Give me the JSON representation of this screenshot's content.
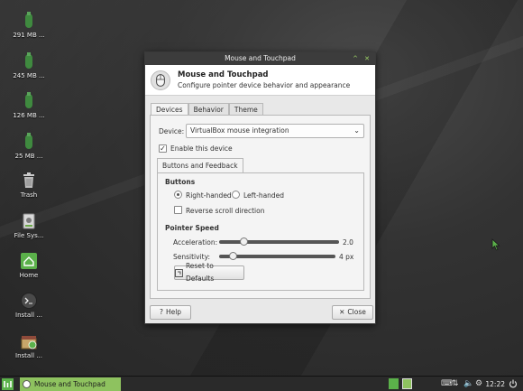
{
  "desktop": {
    "icons": [
      {
        "label": "291 MB ...",
        "icon": "usb-drive-icon"
      },
      {
        "label": "245 MB ...",
        "icon": "usb-drive-icon"
      },
      {
        "label": "126 MB ...",
        "icon": "usb-drive-icon"
      },
      {
        "label": "25 MB ...",
        "icon": "usb-drive-icon"
      },
      {
        "label": "Trash",
        "icon": "trash-icon"
      },
      {
        "label": "File Sys...",
        "icon": "filesystem-icon"
      },
      {
        "label": "Home",
        "icon": "home-icon"
      },
      {
        "label": "Install ...",
        "icon": "terminal-icon"
      },
      {
        "label": "Install ...",
        "icon": "installer-icon"
      }
    ]
  },
  "window": {
    "title": "Mouse and Touchpad",
    "header_title": "Mouse and Touchpad",
    "header_subtitle": "Configure pointer device behavior and appearance",
    "tabs": [
      "Devices",
      "Behavior",
      "Theme"
    ],
    "device_label": "Device:",
    "device_value": "VirtualBox mouse integration",
    "enable_label": "Enable this device",
    "enable_checked": true,
    "subtab": "Buttons and Feedback",
    "buttons_section": "Buttons",
    "right_handed": "Right-handed",
    "left_handed": "Left-handed",
    "handedness": "right",
    "reverse_scroll": "Reverse scroll direction",
    "reverse_checked": false,
    "pointer_speed_section": "Pointer Speed",
    "acceleration_label": "Acceleration:",
    "acceleration_value": "2.0",
    "acceleration_fraction": 0.2,
    "sensitivity_label": "Sensitivity:",
    "sensitivity_value": "4 px",
    "sensitivity_fraction": 0.12,
    "reset_label": "Reset to Defaults",
    "help_label": "Help",
    "close_label": "Close"
  },
  "taskbar": {
    "task_label": "Mouse and Touchpad",
    "clock": "12:22"
  },
  "colors": {
    "accent": "#8ec25f",
    "titlebar": "#3c3c3c",
    "taskbar": "#2a2a2a"
  }
}
